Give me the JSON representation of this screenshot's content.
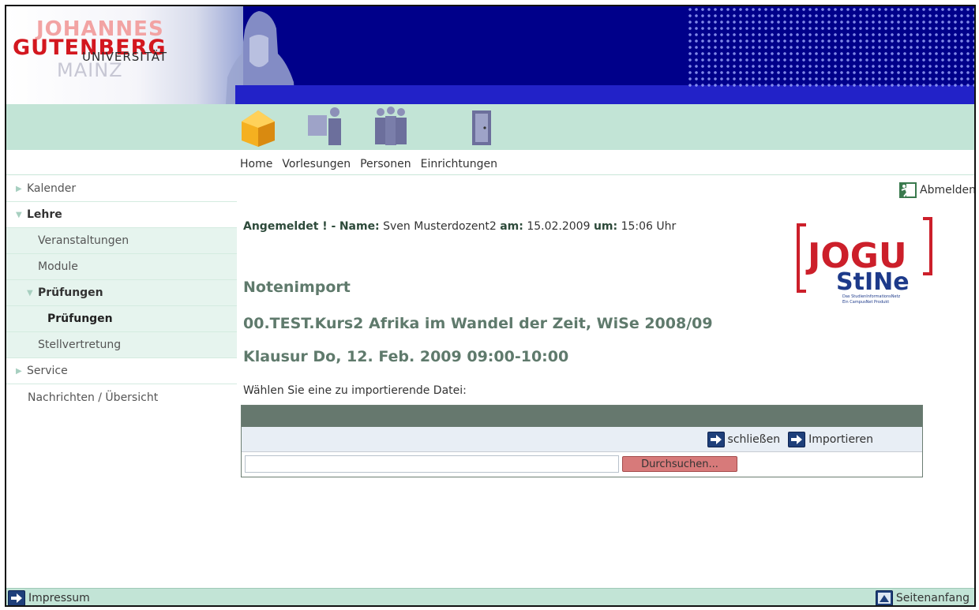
{
  "logo": {
    "line1": "JOHANNES",
    "line2": "GUTENBERG",
    "line3": "UNIVERSITÄT",
    "line4": "MAINZ"
  },
  "icons": [
    "home-icon",
    "lectures-icon",
    "persons-icon",
    "institutions-icon"
  ],
  "nav": {
    "home": "Home",
    "lectures": "Vorlesungen",
    "persons": "Personen",
    "institutions": "Einrichtungen"
  },
  "sidebar": {
    "items": [
      {
        "label": "Kalender"
      },
      {
        "label": "Lehre"
      },
      {
        "label": "Veranstaltungen"
      },
      {
        "label": "Module"
      },
      {
        "label": "Prüfungen"
      },
      {
        "label": "Prüfungen"
      },
      {
        "label": "Stellvertretung"
      },
      {
        "label": "Service"
      },
      {
        "label": "Nachrichten / Übersicht"
      }
    ]
  },
  "main": {
    "logout_label": "Abmelden",
    "login": {
      "status": "Angemeldet ! -",
      "name_label": "Name:",
      "name": "Sven Musterdozent2",
      "date_label": "am:",
      "date": "15.02.2009",
      "time_label": "um:",
      "time": "15:06 Uhr"
    },
    "brand_logo": {
      "jogu": "JOGU",
      "stine": "StINe",
      "tag1": "Das StudienInformationsNetz",
      "tag2": "Ein CampusNet Produkt"
    },
    "title": "Notenimport",
    "course": "00.TEST.Kurs2 Afrika im Wandel der Zeit, WiSe 2008/09",
    "exam": "Klausur Do, 12. Feb. 2009 09:00-10:00",
    "choose_file_label": "Wählen Sie eine zu importierende Datei:",
    "close_label": "schließen",
    "import_label": "Importieren",
    "file_value": "",
    "browse_label": "Durchsuchen..."
  },
  "footer": {
    "imprint": "Impressum",
    "top": "Seitenanfang"
  }
}
